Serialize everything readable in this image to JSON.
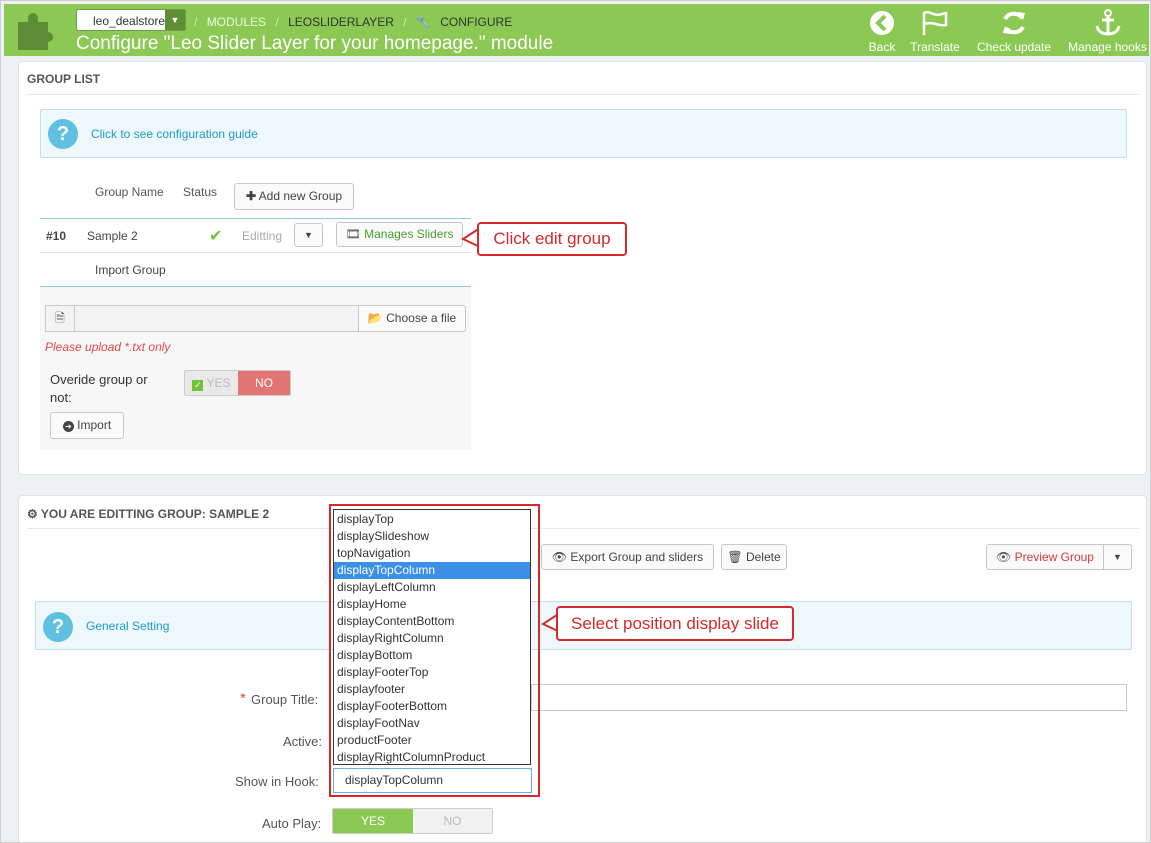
{
  "header": {
    "store": "leo_dealstore",
    "breadcrumb": [
      "MODULES",
      "LEOSLIDERLAYER",
      "CONFIGURE"
    ],
    "title": "Configure \"Leo Slider Layer for your homepage.\" module",
    "actions": [
      {
        "label": "Back",
        "icon": "arrow-left-circle-icon"
      },
      {
        "label": "Translate",
        "icon": "flag-icon"
      },
      {
        "label": "Check update",
        "icon": "refresh-icon"
      },
      {
        "label": "Manage hooks",
        "icon": "anchor-icon"
      }
    ]
  },
  "group_list": {
    "heading": "GROUP LIST",
    "guide_link": "Click to see configuration guide",
    "columns": {
      "name": "Group Name",
      "status": "Status"
    },
    "add_button": "Add new Group",
    "row": {
      "id": "#10",
      "name": "Sample 2",
      "action": "Editting",
      "manage": "Manages Sliders"
    },
    "import_label": "Import Group",
    "choose_file": "Choose a file",
    "upload_hint": "Please upload *.txt only",
    "override_label_1": "Overide group or",
    "override_label_2": "not:",
    "override_yes": "YES",
    "override_no": "NO",
    "import_button": "Import"
  },
  "callouts": {
    "edit_group": "Click edit group",
    "position": "Select position display slide"
  },
  "editing": {
    "heading": "YOU ARE EDITTING GROUP: SAMPLE 2",
    "export_button": "Export Group and sliders",
    "delete_button": "Delete",
    "preview_button": "Preview Group",
    "general_setting": "General Setting",
    "required_mark": "*",
    "fields": {
      "group_title": "Group Title:",
      "active": "Active:",
      "show_in_hook": "Show in Hook:",
      "auto_play": "Auto Play:"
    },
    "auto_play_yes": "YES",
    "auto_play_no": "NO",
    "hook_value": "displayTopColumn",
    "hook_options": [
      "displayTop",
      "displaySlideshow",
      "topNavigation",
      "displayTopColumn",
      "displayLeftColumn",
      "displayHome",
      "displayContentBottom",
      "displayRightColumn",
      "displayBottom",
      "displayFooterTop",
      "displayfooter",
      "displayFooterBottom",
      "displayFootNav",
      "productFooter",
      "displayRightColumnProduct"
    ],
    "hook_selected_index": 3
  },
  "colors": {
    "header_green": "#8bc954",
    "link_blue": "#1a9cc7",
    "callout_red": "#d42a2a",
    "toggle_green": "#8bc954",
    "toggle_red": "#e37474"
  }
}
